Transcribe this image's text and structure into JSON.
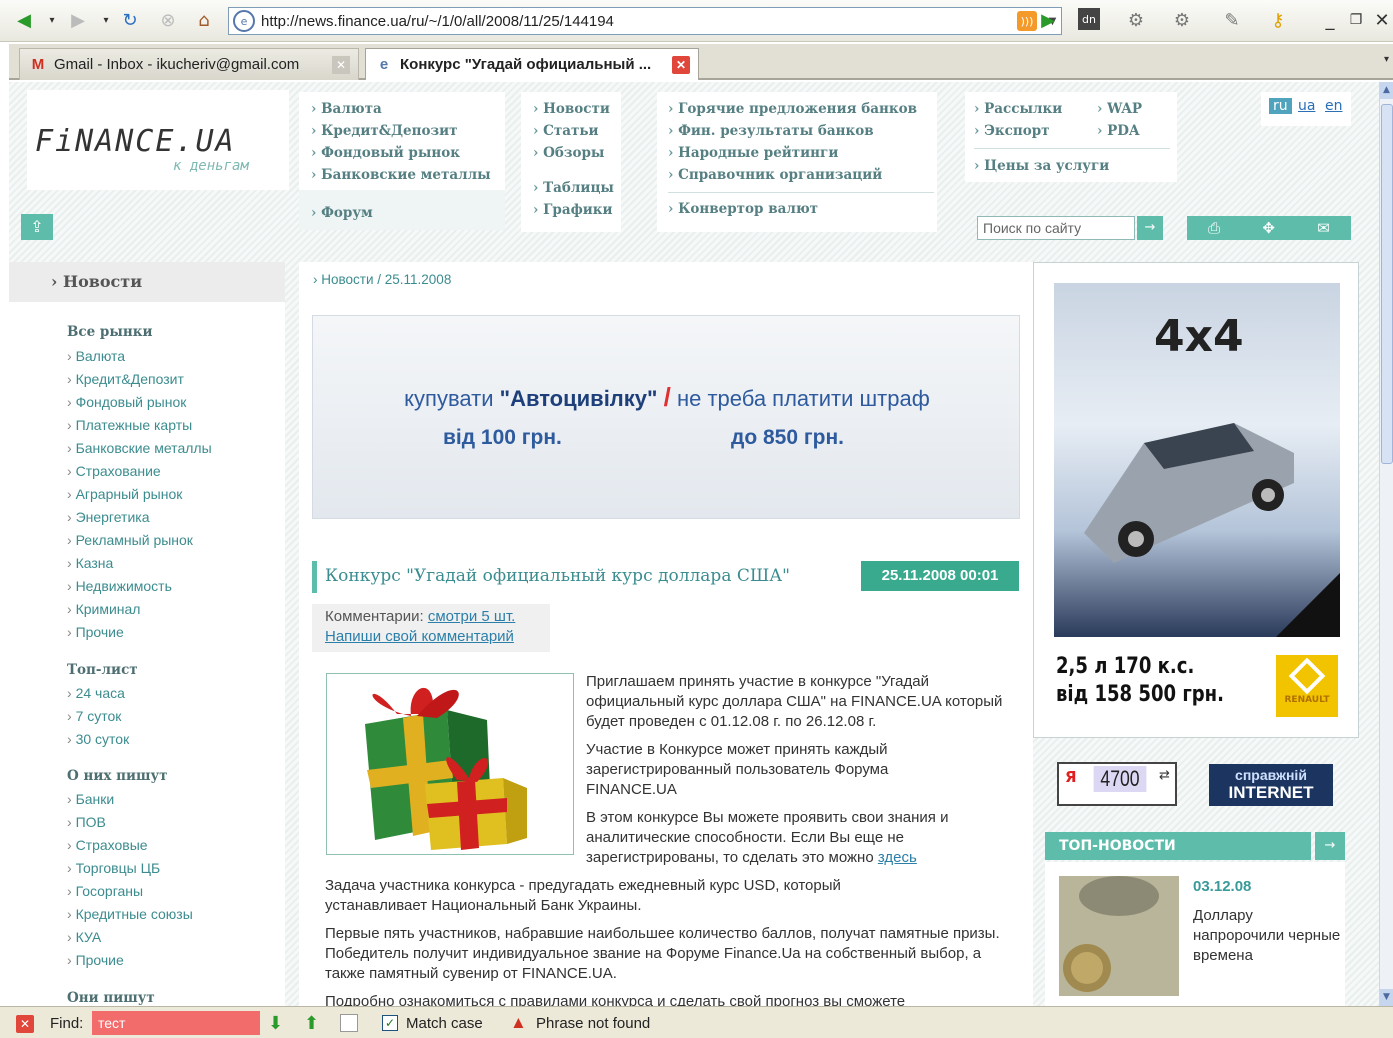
{
  "browser": {
    "url": "http://news.finance.ua/ru/~/1/0/all/2008/11/25/144194",
    "tabs": [
      {
        "label": "Gmail - Inbox - ikucheriv@gmail.com"
      },
      {
        "label": "Конкурс \"Угадай официальный ..."
      }
    ]
  },
  "site": {
    "logo": "FiNANCE.UA",
    "tagline": "к деньгам",
    "nav_col1": [
      "Валюта",
      "Кредит&Депозит",
      "Фондовый рынок",
      "Банковские металлы"
    ],
    "nav_col1_extra": "Форум",
    "nav_col2": [
      "Новости",
      "Статьи",
      "Обзоры"
    ],
    "nav_col2_extra": [
      "Таблицы",
      "Графики"
    ],
    "nav_col3": [
      "Горячие предложения банков",
      "Фин. результаты банков",
      "Народные рейтинги",
      "Справочник организаций"
    ],
    "nav_col3_extra": "Конвертор валют",
    "nav_col4": [
      "Рассылки",
      "Экспорт"
    ],
    "nav_col4_extra": "Цены за услуги",
    "nav_col5": [
      "WAP",
      "PDA"
    ],
    "langs": [
      "ru",
      "ua",
      "en"
    ],
    "search_placeholder": "Поиск по сайту"
  },
  "sidebar": {
    "header": "Новости",
    "groups": [
      {
        "title": "Все рынки",
        "items": [
          "Валюта",
          "Кредит&Депозит",
          "Фондовый рынок",
          "Платежные карты",
          "Банковские металлы",
          "Страхование",
          "Аграрный рынок",
          "Энергетика",
          "Рекламный рынок",
          "Казна",
          "Недвижимость",
          "Криминал",
          "Прочие"
        ]
      },
      {
        "title": "Топ-лист",
        "items": [
          "24 часа",
          "7 суток",
          "30 суток"
        ]
      },
      {
        "title": "О них пишут",
        "items": [
          "Банки",
          "ПОВ",
          "Страховые",
          "Торговцы ЦБ",
          "Госорганы",
          "Кредитные союзы",
          "КУА",
          "Прочие"
        ]
      },
      {
        "title": "Они пишут",
        "items": []
      }
    ]
  },
  "content": {
    "breadcrumb": "Новости / 25.11.2008",
    "banner": {
      "l1_pre": "купувати ",
      "l1_bold": "\"Автоцивілку\"",
      "l1_slash": "/",
      "l1_post": " не треба платити штраф",
      "price_from": "від 100 грн.",
      "price_to": "до 850 грн."
    },
    "article": {
      "title": "Конкурс \"Угадай официальный курс доллара США\"",
      "date": "25.11.2008 00:01",
      "comments_label": "Комментарии: ",
      "comments_link": "смотри 5 шт.",
      "write_comment": "Напиши свой комментарий",
      "p1": "Приглашаем принять участие в конкурсе \"Угадай официальный курс доллара США\" на FINANCE.UA который будет проведен с 01.12.08 г. по 26.12.08 г.",
      "p2": "Участие в Конкурсе может принять каждый зарегистрированный пользователь Форума FINANCE.UA",
      "p3": "В этом конкурсе Вы можете проявить свои знания и аналитические способности. Если Вы еще не зарегистрированы, то сделать это можно ",
      "p3_link": "здесь",
      "p4": "Задача участника конкурса - предугадать ежедневный курс USD, который устанавливает Национальный Банк Украины.",
      "p5": "Первые пять участников, набравшие наибольшее количество баллов, получат памятные призы. Победитель получит индивидуальное звание на Форуме Finance.Ua на собственный выбор, а также памятный сувенир от FINANCE.UA.",
      "p6": "Подробно ознакомиться с правилами конкурса и сделать свой прогноз вы сможете"
    }
  },
  "right": {
    "ad_headline": "4x4",
    "ad_price_l1": "2,5 л 170 к.с.",
    "ad_price_l2": "від 158 500 грн.",
    "ad_brand": "RENAULT",
    "counter_ya": "Я",
    "counter_value": "4700",
    "sprav_l1": "справжній",
    "sprav_l2": "INTERNET",
    "top_news_title": "ТОП-НОВОСТИ",
    "news_date": "03.12.08",
    "news_text": "Доллару напророчили черные времена"
  },
  "findbar": {
    "label": "Find:",
    "value": "тест",
    "match_case": "Match case",
    "status": "Phrase not found"
  }
}
